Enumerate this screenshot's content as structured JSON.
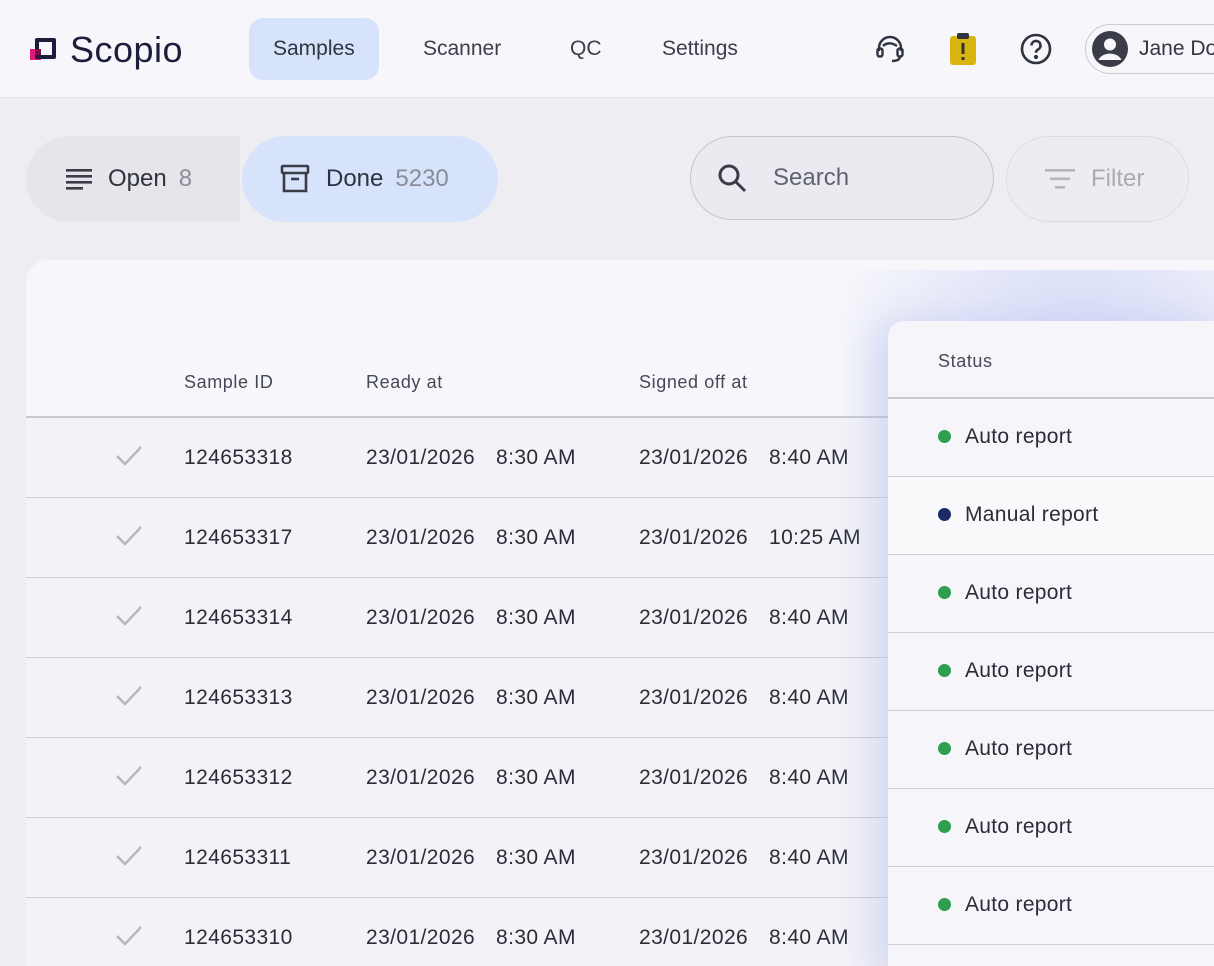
{
  "app": {
    "name": "Scopio",
    "brand_colors": {
      "pink": "#e0187a",
      "navy": "#1b1d3a"
    }
  },
  "nav": {
    "tabs": [
      {
        "label": "Samples",
        "active": true
      },
      {
        "label": "Scanner",
        "active": false
      },
      {
        "label": "QC",
        "active": false
      },
      {
        "label": "Settings",
        "active": false
      }
    ]
  },
  "header_icons": [
    "support-agent-icon",
    "clipboard-alert-icon",
    "help-icon",
    "user-avatar-icon"
  ],
  "user": {
    "name": "Jane Do"
  },
  "toolbar": {
    "open": {
      "label": "Open",
      "count": "8",
      "icon": "list-icon"
    },
    "done": {
      "label": "Done",
      "count": "5230",
      "icon": "archive-box-icon",
      "active": true
    },
    "search": {
      "placeholder": "Search",
      "icon": "search-icon"
    },
    "filter": {
      "label": "Filter",
      "icon": "filter-icon",
      "disabled": true
    }
  },
  "table": {
    "columns": [
      "Sample ID",
      "Ready at",
      "Signed off at"
    ],
    "status_header": "Status",
    "rows": [
      {
        "id": "124653318",
        "ready_date": "23/01/2026",
        "ready_time": "8:30 AM",
        "signed_date": "23/01/2026",
        "signed_time": "8:40 AM"
      },
      {
        "id": "124653317",
        "ready_date": "23/01/2026",
        "ready_time": "8:30 AM",
        "signed_date": "23/01/2026",
        "signed_time": "10:25 AM"
      },
      {
        "id": "124653314",
        "ready_date": "23/01/2026",
        "ready_time": "8:30 AM",
        "signed_date": "23/01/2026",
        "signed_time": "8:40 AM"
      },
      {
        "id": "124653313",
        "ready_date": "23/01/2026",
        "ready_time": "8:30 AM",
        "signed_date": "23/01/2026",
        "signed_time": "8:40 AM"
      },
      {
        "id": "124653312",
        "ready_date": "23/01/2026",
        "ready_time": "8:30 AM",
        "signed_date": "23/01/2026",
        "signed_time": "8:40 AM"
      },
      {
        "id": "124653311",
        "ready_date": "23/01/2026",
        "ready_time": "8:30 AM",
        "signed_date": "23/01/2026",
        "signed_time": "8:40 AM"
      },
      {
        "id": "124653310",
        "ready_date": "23/01/2026",
        "ready_time": "8:30 AM",
        "signed_date": "23/01/2026",
        "signed_time": "8:40 AM"
      }
    ],
    "statuses": [
      {
        "label": "Auto report",
        "color": "#2e9e4f"
      },
      {
        "label": "Manual report",
        "color": "#1e2a66"
      },
      {
        "label": "Auto report",
        "color": "#2e9e4f"
      },
      {
        "label": "Auto report",
        "color": "#2e9e4f"
      },
      {
        "label": "Auto report",
        "color": "#2e9e4f"
      },
      {
        "label": "Auto report",
        "color": "#2e9e4f"
      },
      {
        "label": "Auto report",
        "color": "#2e9e4f"
      }
    ]
  }
}
